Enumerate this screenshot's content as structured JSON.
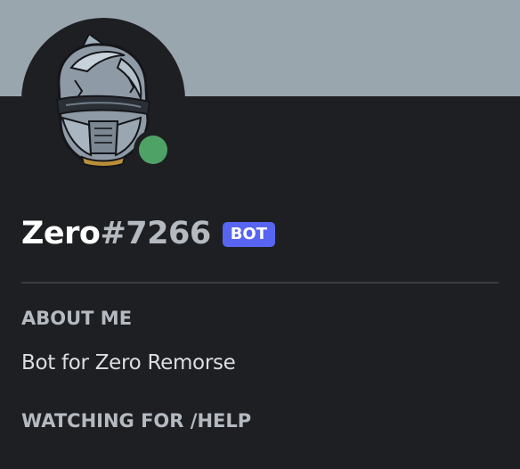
{
  "profile": {
    "username": "Zero",
    "discriminator": "#7266",
    "badge": "BOT",
    "status": "online",
    "status_color": "#4fa265"
  },
  "sections": {
    "about_heading": "ABOUT ME",
    "about_text": "Bot for Zero Remorse",
    "activity_heading": "WATCHING FOR /HELP"
  },
  "colors": {
    "banner": "#9aa6ad",
    "background": "#1e1f22",
    "badge": "#5865f2"
  },
  "icons": {
    "avatar": "armored-knight-helmet"
  }
}
